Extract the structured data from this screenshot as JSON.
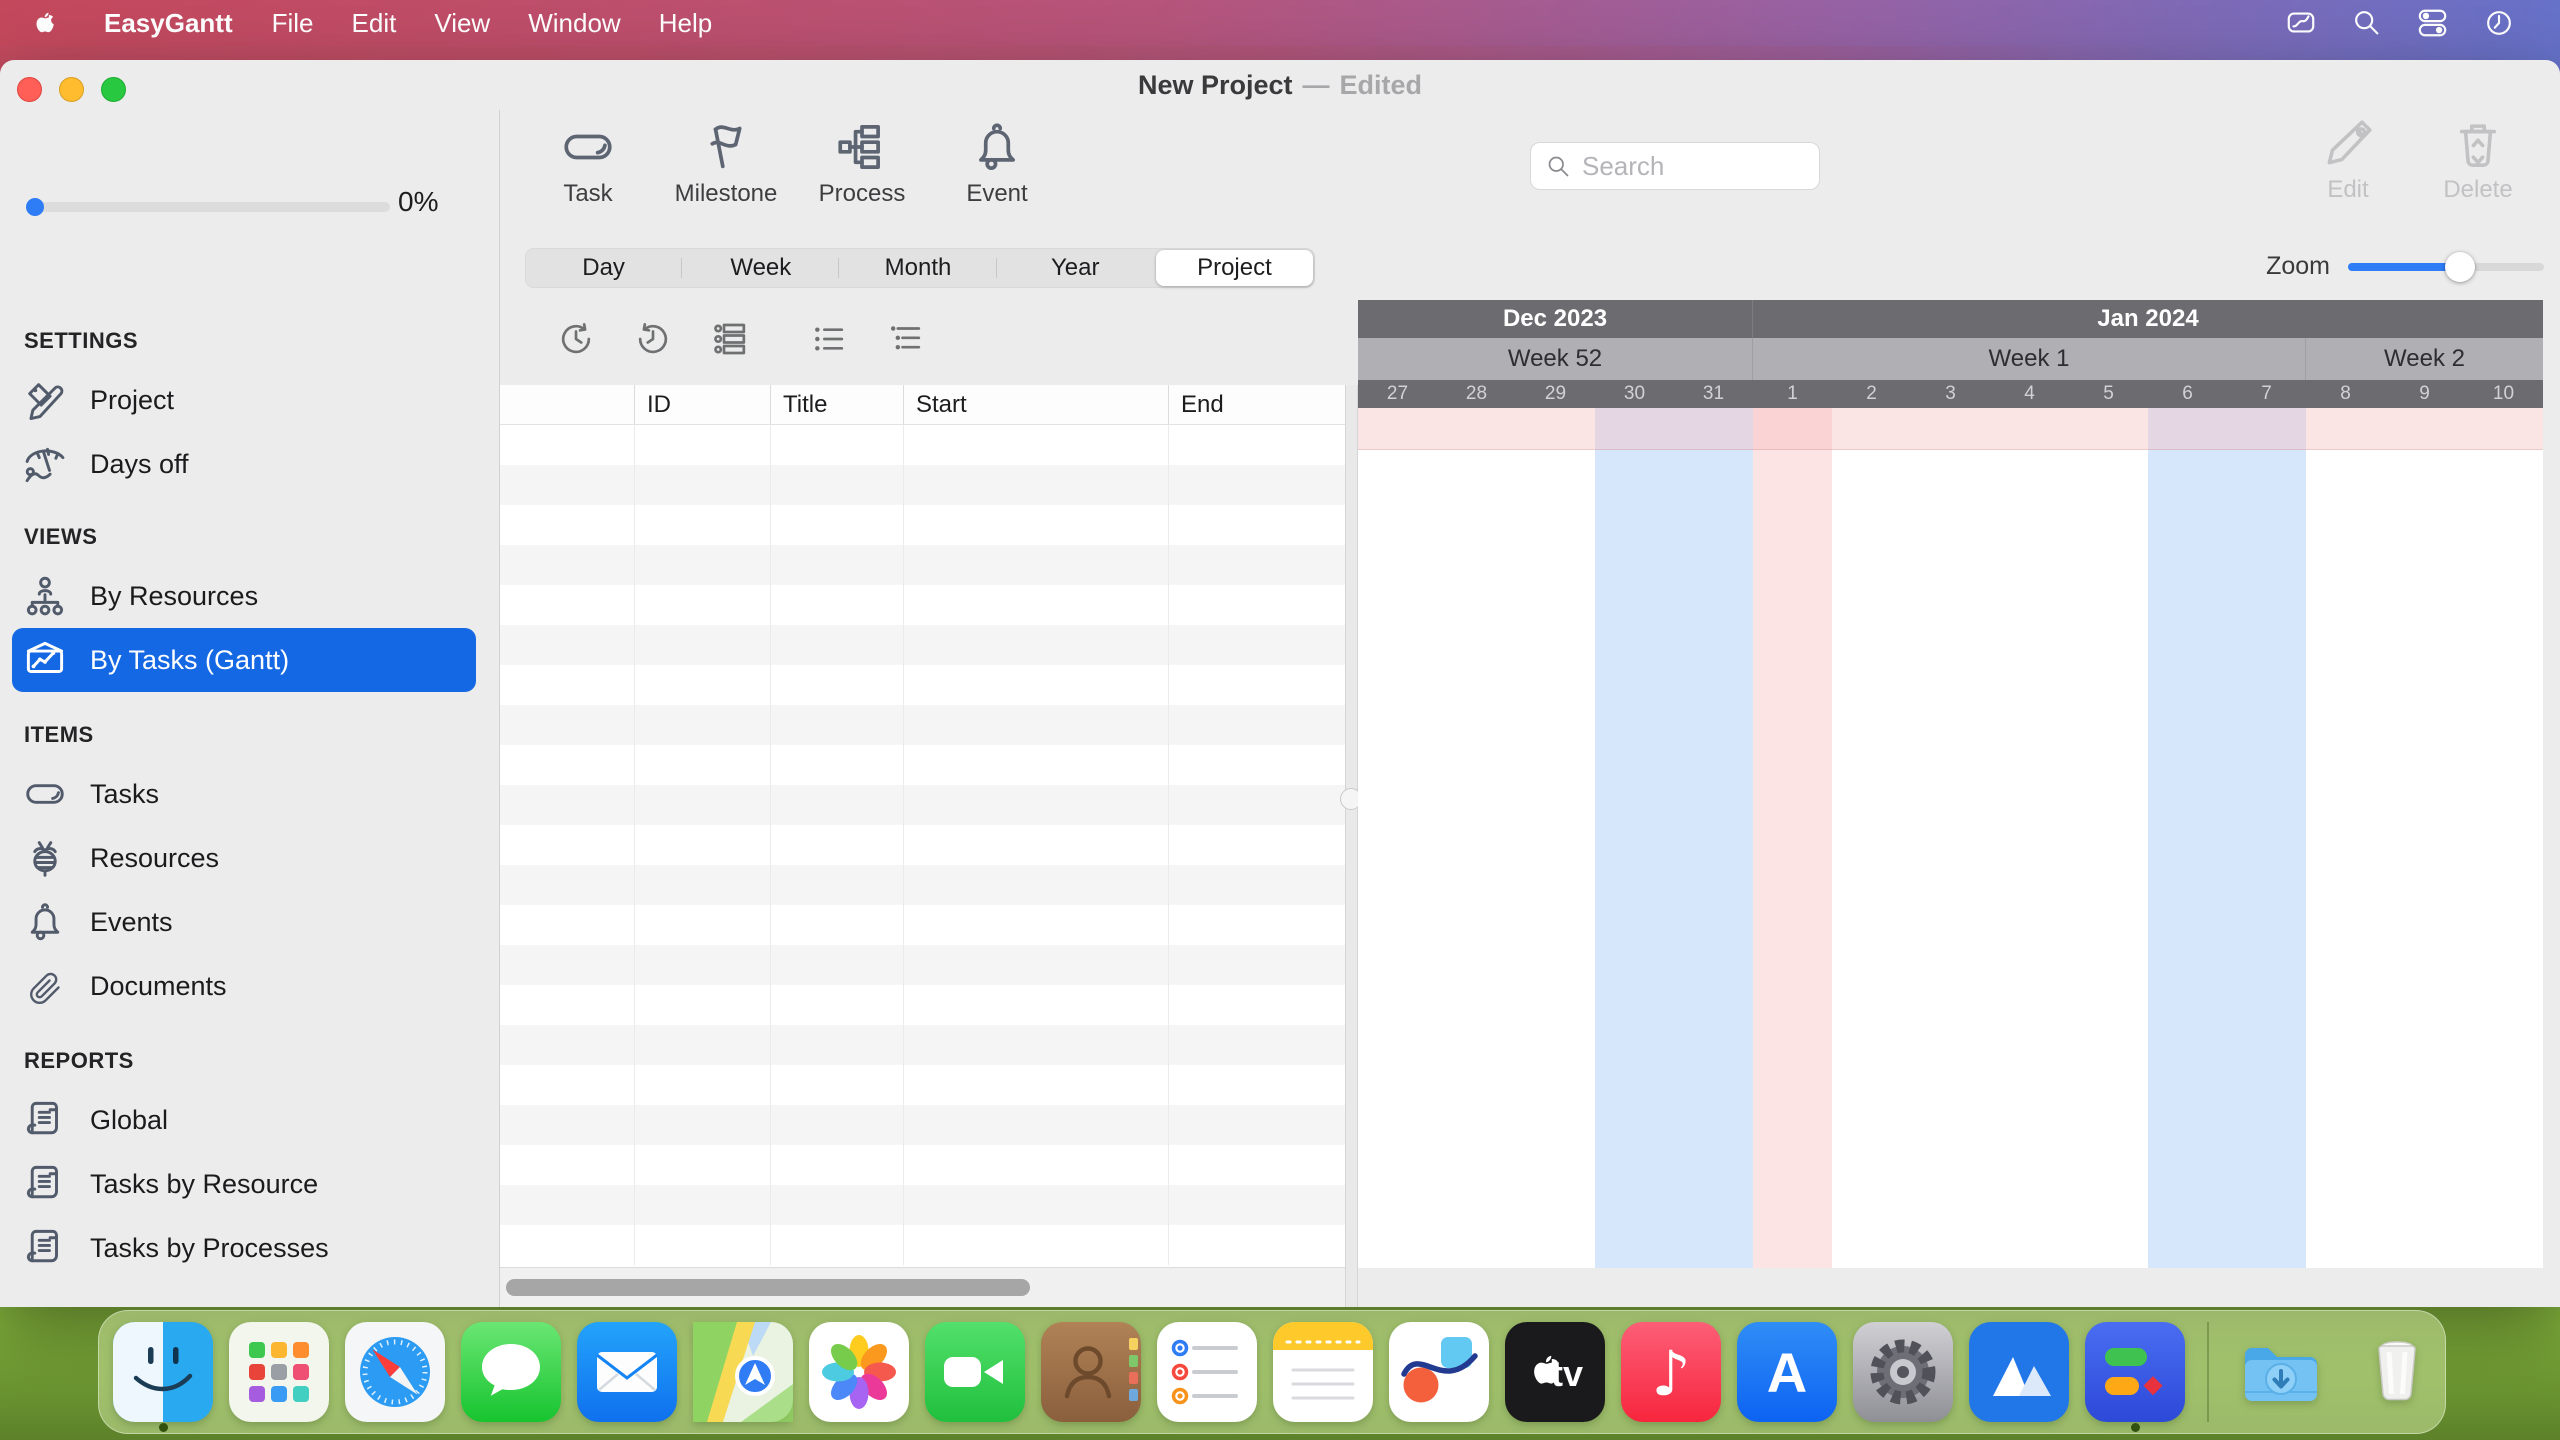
{
  "menu_bar": {
    "app_name": "EasyGantt",
    "items": [
      "File",
      "Edit",
      "View",
      "Window",
      "Help"
    ],
    "status_icons": [
      "screen-mirroring",
      "search",
      "control-center",
      "clock"
    ]
  },
  "window_title": {
    "name": "New Project",
    "separator": "—",
    "status": "Edited"
  },
  "sidebar": {
    "progress_label": "0%",
    "progress_value_pct": 0,
    "sections": [
      {
        "title": "SETTINGS",
        "items": [
          {
            "label": "Project",
            "icon": "pencil"
          },
          {
            "label": "Days off",
            "icon": "umbrella"
          }
        ]
      },
      {
        "title": "VIEWS",
        "items": [
          {
            "label": "By Resources",
            "icon": "orgtree"
          },
          {
            "label": "By Tasks (Gantt)",
            "icon": "ganttboard",
            "selected": true
          }
        ]
      },
      {
        "title": "ITEMS",
        "items": [
          {
            "label": "Tasks",
            "icon": "capsule"
          },
          {
            "label": "Resources",
            "icon": "bee"
          },
          {
            "label": "Events",
            "icon": "bell"
          },
          {
            "label": "Documents",
            "icon": "clip"
          }
        ]
      },
      {
        "title": "REPORTS",
        "items": [
          {
            "label": "Global",
            "icon": "scroll"
          },
          {
            "label": "Tasks by Resource",
            "icon": "scroll"
          },
          {
            "label": "Tasks by Processes",
            "icon": "scroll"
          }
        ]
      }
    ]
  },
  "toolbar": {
    "create_buttons": [
      {
        "label": "Task",
        "icon": "capsule"
      },
      {
        "label": "Milestone",
        "icon": "flag"
      },
      {
        "label": "Process",
        "icon": "hierarchy"
      },
      {
        "label": "Event",
        "icon": "bell"
      }
    ],
    "scale_segments": [
      "Day",
      "Week",
      "Month",
      "Year",
      "Project"
    ],
    "scale_selected": "Project",
    "search_placeholder": "Search",
    "edit_label": "Edit",
    "delete_label": "Delete",
    "zoom_label": "Zoom",
    "zoom_value_pct": 57
  },
  "list_toolbar": {
    "icons": [
      "clock-forward",
      "clock-backward",
      "detail-list",
      "bullet-list",
      "outline-list"
    ]
  },
  "table": {
    "columns": [
      "",
      "ID",
      "Title",
      "Start",
      "End"
    ],
    "row_count": 21,
    "rows": []
  },
  "gantt": {
    "months": [
      {
        "label": "Dec 2023",
        "span": 5
      },
      {
        "label": "Jan 2024",
        "span": 10
      }
    ],
    "weeks": [
      {
        "label": "Week 52",
        "span": 5
      },
      {
        "label": "Week 1",
        "span": 7
      },
      {
        "label": "Week 2",
        "span": 3
      }
    ],
    "days": [
      {
        "label": "27",
        "kind": "normal"
      },
      {
        "label": "28",
        "kind": "normal"
      },
      {
        "label": "29",
        "kind": "normal"
      },
      {
        "label": "30",
        "kind": "weekend"
      },
      {
        "label": "31",
        "kind": "weekend"
      },
      {
        "label": "1",
        "kind": "holiday"
      },
      {
        "label": "2",
        "kind": "normal"
      },
      {
        "label": "3",
        "kind": "normal"
      },
      {
        "label": "4",
        "kind": "normal"
      },
      {
        "label": "5",
        "kind": "normal"
      },
      {
        "label": "6",
        "kind": "weekend"
      },
      {
        "label": "7",
        "kind": "weekend"
      },
      {
        "label": "8",
        "kind": "normal"
      },
      {
        "label": "9",
        "kind": "normal"
      },
      {
        "label": "10",
        "kind": "normal"
      }
    ]
  },
  "dock": {
    "apps": [
      {
        "id": "finder",
        "name": "Finder",
        "running": true
      },
      {
        "id": "launchpad",
        "name": "Launchpad"
      },
      {
        "id": "safari",
        "name": "Safari"
      },
      {
        "id": "messages",
        "name": "Messages"
      },
      {
        "id": "mail",
        "name": "Mail"
      },
      {
        "id": "maps",
        "name": "Maps"
      },
      {
        "id": "photos",
        "name": "Photos"
      },
      {
        "id": "facetime",
        "name": "FaceTime"
      },
      {
        "id": "contacts",
        "name": "Contacts"
      },
      {
        "id": "reminders",
        "name": "Reminders"
      },
      {
        "id": "notes",
        "name": "Notes"
      },
      {
        "id": "freeform",
        "name": "Freeform"
      },
      {
        "id": "appletv",
        "name": "Apple TV"
      },
      {
        "id": "music",
        "name": "Music"
      },
      {
        "id": "appstore",
        "name": "App Store"
      },
      {
        "id": "settings",
        "name": "System Settings"
      },
      {
        "id": "mountains",
        "name": "Mountains App"
      },
      {
        "id": "easygantt",
        "name": "EasyGantt",
        "running": true
      },
      {
        "id": "divider"
      },
      {
        "id": "downloads",
        "name": "Downloads"
      },
      {
        "id": "trash",
        "name": "Trash"
      }
    ]
  },
  "colors": {
    "accent_selected": "#1568e4",
    "slider_fill": "#2e7cf6",
    "weekend_fill": "#d7e7fb",
    "holiday_fill": "#fde4e4",
    "gantt_header_dark": "#6c6c70",
    "gantt_header_light": "#b0b0b4",
    "traffic_close": "#ff5f57",
    "traffic_minimize": "#febc2e",
    "traffic_zoom": "#28c840"
  }
}
